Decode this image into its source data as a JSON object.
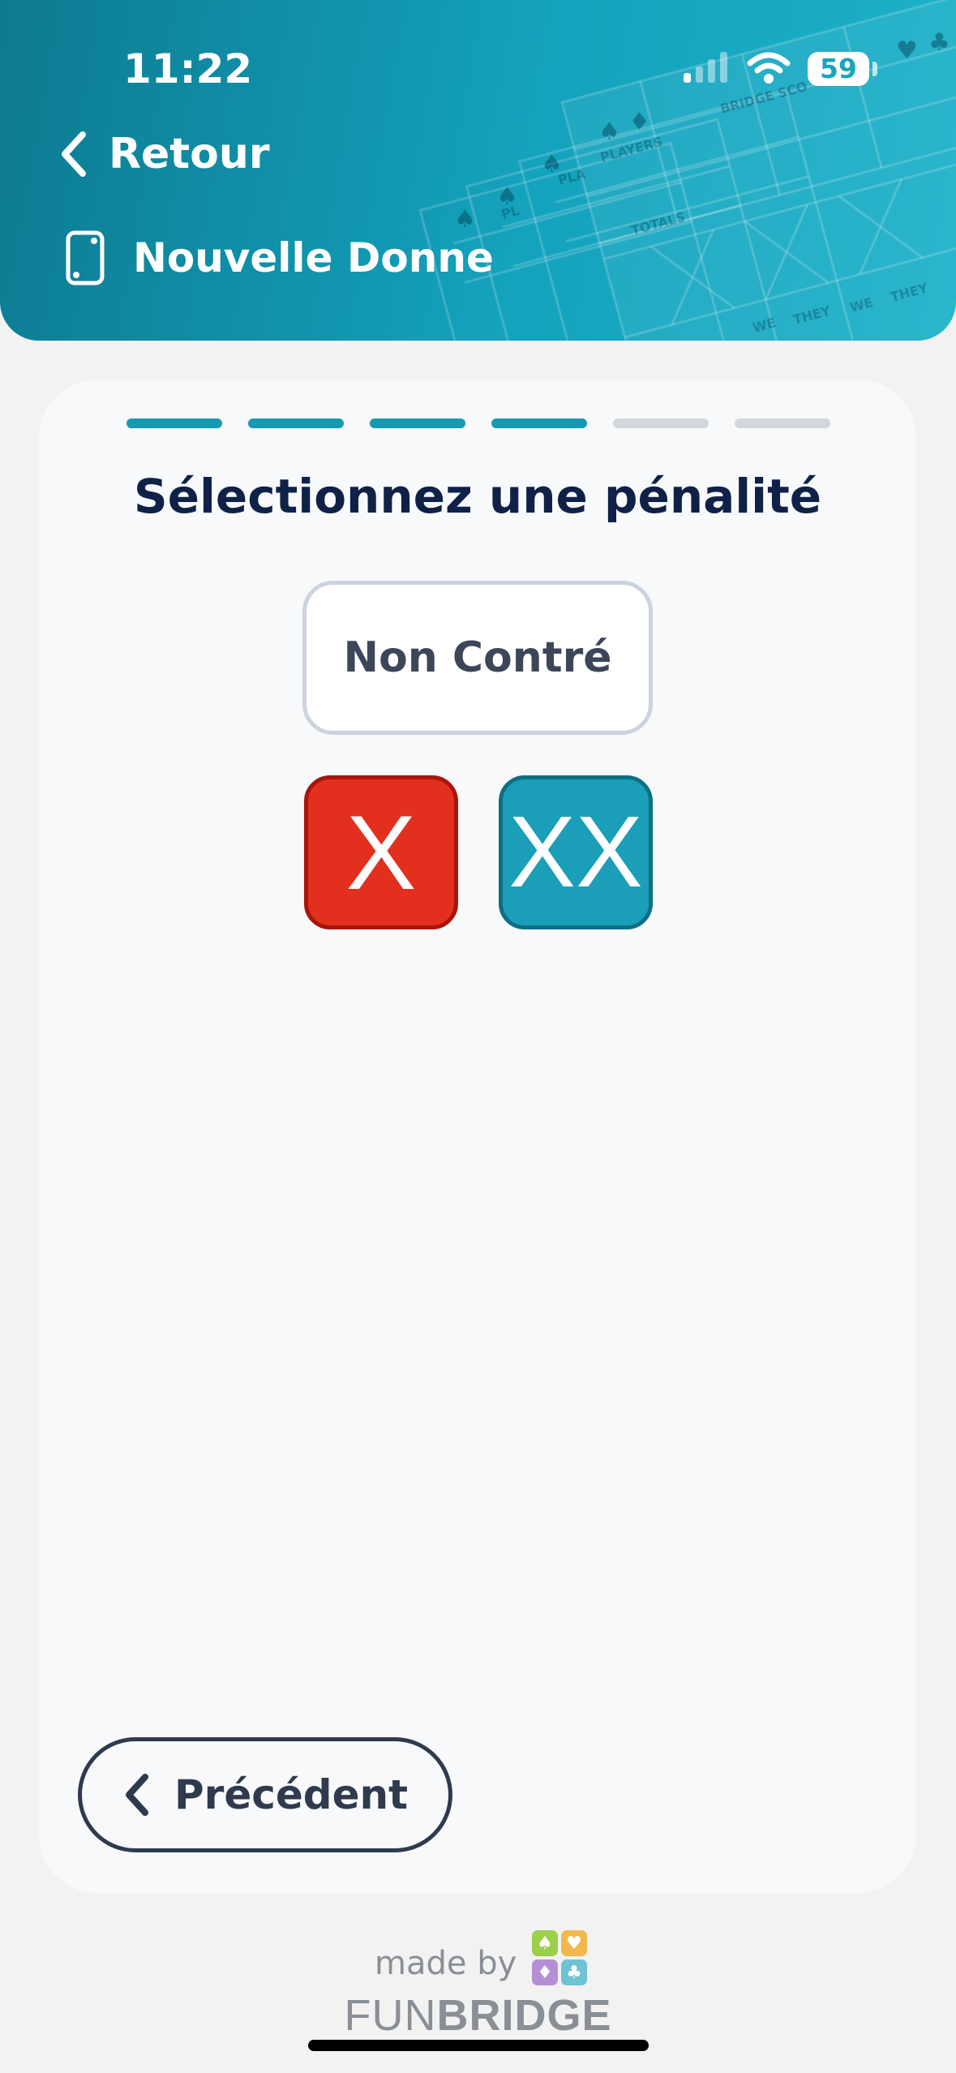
{
  "status_bar": {
    "time": "11:22",
    "battery": "59"
  },
  "header": {
    "back_label": "Retour",
    "screen_title": "Nouvelle Donne",
    "background_text": [
      "BRIDGE SCO",
      "PLAYERS",
      "TOTALS",
      "PLA",
      "PL",
      "WE",
      "THEY"
    ]
  },
  "wizard": {
    "steps_total": 6,
    "steps_done": 4,
    "title": "Sélectionnez une pénalité",
    "options": {
      "none": "Non Contré",
      "double": "X",
      "redouble": "XX"
    },
    "previous_label": "Précédent"
  },
  "footer": {
    "made_by": "made by",
    "brand_part1": "FUN",
    "brand_part2": "BRIDGE",
    "logo_suits": [
      "♠",
      "♥",
      "♦",
      "♣"
    ]
  },
  "colors": {
    "header": "#1aa4bd",
    "accent": "#1699b3",
    "double": "#e3301e",
    "redouble": "#1b9eb7",
    "title": "#0f2147"
  }
}
